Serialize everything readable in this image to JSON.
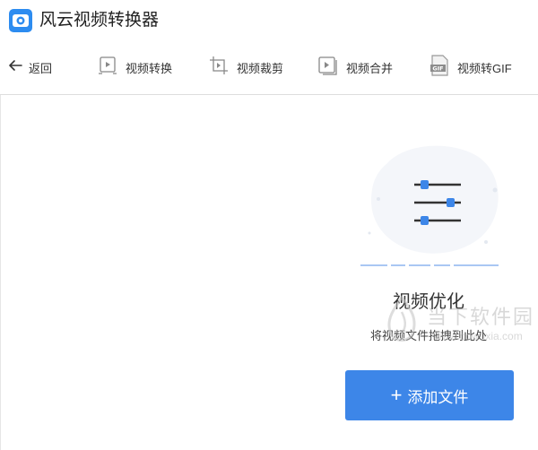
{
  "app": {
    "title": "风云视频转换器",
    "accent_color": "#2d8cf0"
  },
  "toolbar": {
    "back_label": "返回",
    "tools": [
      {
        "label": "视频转换",
        "icon": "video-convert-icon"
      },
      {
        "label": "视频裁剪",
        "icon": "video-crop-icon"
      },
      {
        "label": "视频合并",
        "icon": "video-merge-icon"
      },
      {
        "label": "视频转GIF",
        "icon": "gif-file-icon"
      }
    ]
  },
  "main": {
    "feature_title": "视频优化",
    "hint": "将视频文件拖拽到此处",
    "add_button_label": "添加文件",
    "button_color": "#3d86e8"
  },
  "watermark": {
    "text": "当下软件园",
    "url": "www.downxia.com"
  }
}
